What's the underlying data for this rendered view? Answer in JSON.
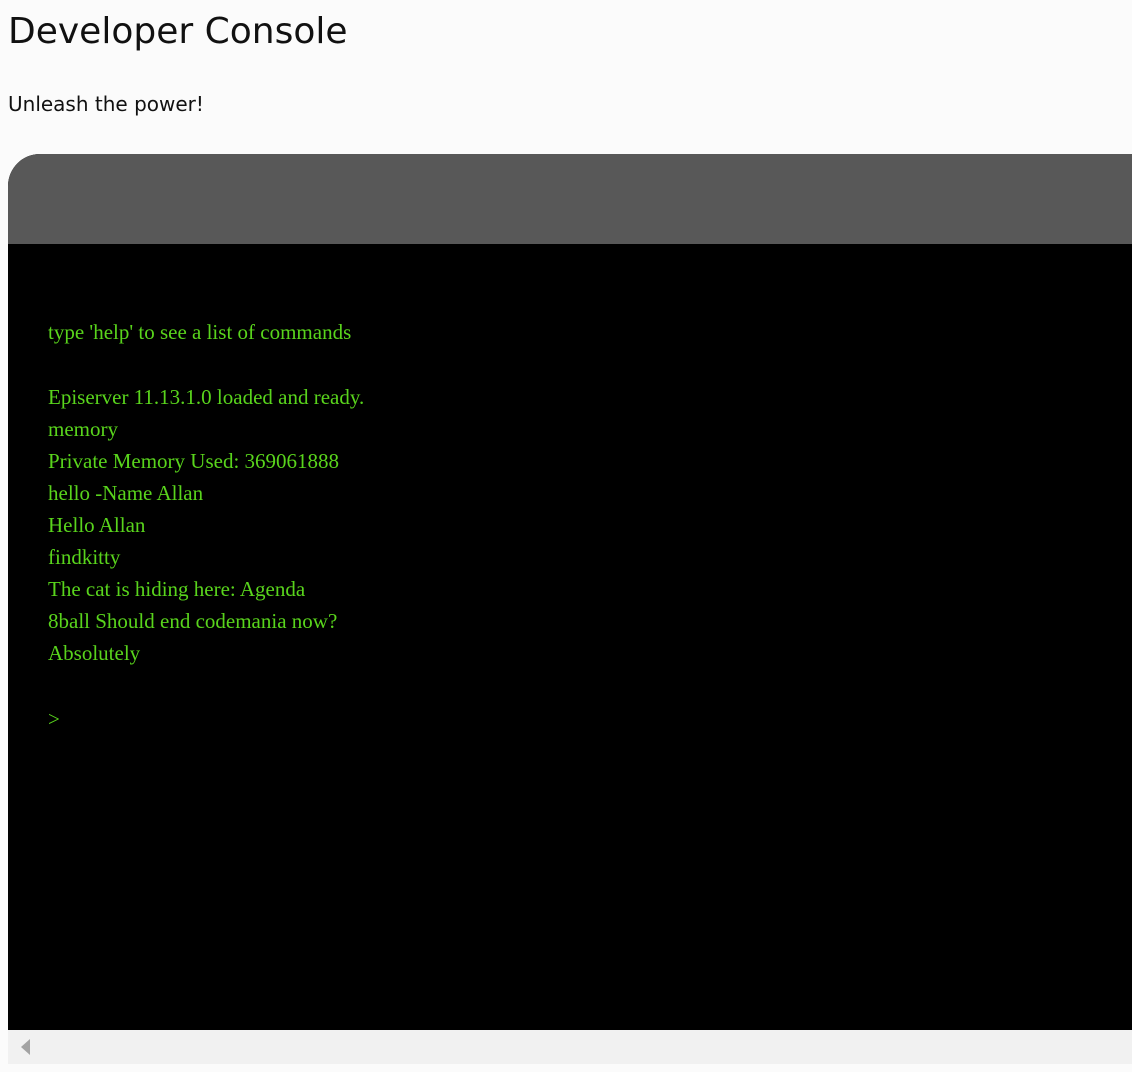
{
  "page": {
    "title": "Developer Console",
    "subtitle": "Unleash the power!"
  },
  "console": {
    "lines": [
      "type 'help' to see a list of commands",
      "",
      "Episerver 11.13.1.0 loaded and ready.",
      "memory",
      "Private Memory Used: 369061888",
      "hello -Name Allan",
      "Hello Allan",
      "findkitty",
      "The cat is hiding here: Agenda",
      "8ball Should end codemania now?",
      "Absolutely"
    ],
    "prompt_symbol": ">",
    "input_value": ""
  },
  "colors": {
    "console_text": "#59d41c",
    "console_background": "#000000",
    "titlebar": "#585858",
    "page_background": "#fbfbfb"
  },
  "icons": {
    "scroll_left": "triangle-left-icon"
  }
}
